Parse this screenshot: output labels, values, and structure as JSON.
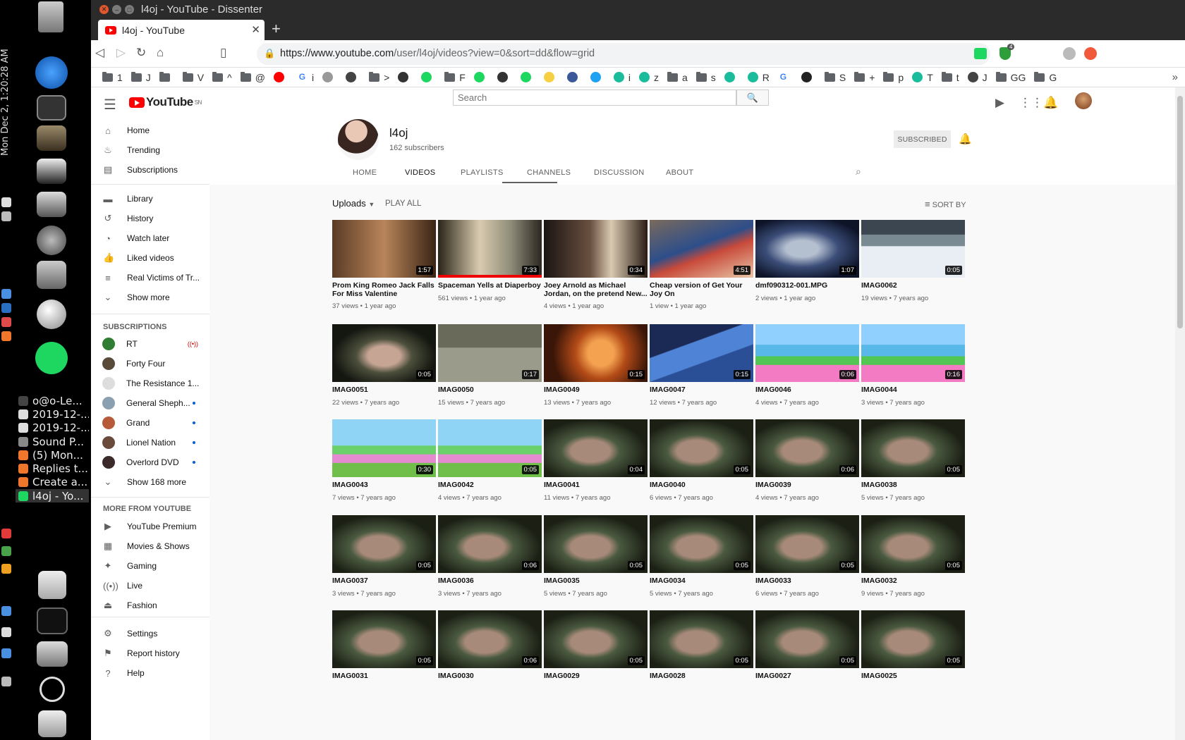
{
  "desktop": {
    "clock": "Mon Dec 2,  1:20:28 AM",
    "windows": [
      {
        "label": "o@o-Le...",
        "color": "#444"
      },
      {
        "label": "2019-12-...",
        "color": "#ddd"
      },
      {
        "label": "2019-12-...",
        "color": "#ddd"
      },
      {
        "label": "Sound P...",
        "color": "#888"
      },
      {
        "label": "(5) Mon...",
        "color": "#f0762c"
      },
      {
        "label": "Replies t...",
        "color": "#f0762c"
      },
      {
        "label": "Create a...",
        "color": "#f0762c"
      },
      {
        "label": "l4oj - Yo...",
        "color": "#1ed760",
        "active": true
      }
    ]
  },
  "browser": {
    "window_title": "l4oj - YouTube - Dissenter",
    "tab_title": "l4oj - YouTube",
    "url_host": "https://www.youtube.com",
    "url_path": "/user/l4oj/videos?view=0&sort=dd&flow=grid",
    "badge_count": "4",
    "bookmarks": [
      {
        "type": "folder",
        "label": "1"
      },
      {
        "type": "folder",
        "label": "J"
      },
      {
        "type": "folder",
        "label": ""
      },
      {
        "type": "folder",
        "label": "V"
      },
      {
        "type": "folder",
        "label": "^"
      },
      {
        "type": "folder",
        "label": "@"
      },
      {
        "type": "fav",
        "label": "",
        "color": "#f00"
      },
      {
        "type": "fav",
        "label": "i",
        "color": "#fff",
        "text": "G"
      },
      {
        "type": "fav",
        "label": "",
        "color": "#999"
      },
      {
        "type": "fav",
        "label": "",
        "color": "#444"
      },
      {
        "type": "folder",
        "label": ">"
      },
      {
        "type": "fav",
        "label": "",
        "color": "#333"
      },
      {
        "type": "fav",
        "label": "",
        "color": "#1ed760"
      },
      {
        "type": "folder",
        "label": "F"
      },
      {
        "type": "fav",
        "label": "",
        "color": "#1ed760"
      },
      {
        "type": "fav",
        "label": "",
        "color": "#333"
      },
      {
        "type": "fav",
        "label": "",
        "color": "#1ed760"
      },
      {
        "type": "fav",
        "label": "",
        "color": "#f5d042"
      },
      {
        "type": "fav",
        "label": "",
        "color": "#3b5998"
      },
      {
        "type": "fav",
        "label": "",
        "color": "#1da1f2"
      },
      {
        "type": "fav",
        "label": "i",
        "color": "#1abc9c"
      },
      {
        "type": "fav",
        "label": "z",
        "color": "#1abc9c"
      },
      {
        "type": "folder",
        "label": "a"
      },
      {
        "type": "folder",
        "label": "s"
      },
      {
        "type": "fav",
        "label": "",
        "color": "#1abc9c"
      },
      {
        "type": "fav",
        "label": "R",
        "color": "#1abc9c"
      },
      {
        "type": "fav",
        "label": "",
        "color": "#fff",
        "text": "G"
      },
      {
        "type": "fav",
        "label": "",
        "color": "#222"
      },
      {
        "type": "folder",
        "label": "S"
      },
      {
        "type": "folder",
        "label": "+"
      },
      {
        "type": "folder",
        "label": "p"
      },
      {
        "type": "fav",
        "label": "T",
        "color": "#1abc9c"
      },
      {
        "type": "folder",
        "label": "t"
      },
      {
        "type": "fav",
        "label": "J",
        "color": "#444"
      },
      {
        "type": "folder",
        "label": "GG"
      },
      {
        "type": "folder",
        "label": "G"
      }
    ]
  },
  "youtube": {
    "logo_text": "YouTube",
    "logo_sup": "SN",
    "search_placeholder": "Search",
    "sidebar": {
      "main": [
        {
          "label": "Home",
          "icon": "home-icon",
          "glyph": "⌂"
        },
        {
          "label": "Trending",
          "icon": "fire-icon",
          "glyph": "♨"
        },
        {
          "label": "Subscriptions",
          "icon": "subscriptions-icon",
          "glyph": "▤"
        }
      ],
      "library": [
        {
          "label": "Library",
          "icon": "folder-icon",
          "glyph": "▬"
        },
        {
          "label": "History",
          "icon": "history-icon",
          "glyph": "↺"
        },
        {
          "label": "Watch later",
          "icon": "clock-icon",
          "glyph": "◔"
        },
        {
          "label": "Liked videos",
          "icon": "thumbs-up-icon",
          "glyph": "👍"
        },
        {
          "label": "Real Victims of Tr...",
          "icon": "playlist-icon",
          "glyph": "≡"
        },
        {
          "label": "Show more",
          "icon": "chevron-down-icon",
          "glyph": "⌄"
        }
      ],
      "subscriptions_heading": "SUBSCRIPTIONS",
      "subscriptions": [
        {
          "label": "RT",
          "color": "#2e7d32",
          "live": true
        },
        {
          "label": "Forty Four",
          "color": "#5a4a3a"
        },
        {
          "label": "The Resistance 1...",
          "color": "#ddd"
        },
        {
          "label": "General Sheph...",
          "color": "#8aa0b0",
          "dot": true
        },
        {
          "label": "Grand",
          "color": "#b65a3a",
          "dot": true
        },
        {
          "label": "Lionel Nation",
          "color": "#6a4a3a",
          "dot": true
        },
        {
          "label": "Overlord DVD",
          "color": "#3a2a2a",
          "dot": true
        }
      ],
      "show_more_subs": "Show 168 more",
      "more_heading": "MORE FROM YOUTUBE",
      "more": [
        {
          "label": "YouTube Premium",
          "icon": "youtube-premium-icon",
          "glyph": "▶"
        },
        {
          "label": "Movies & Shows",
          "icon": "film-icon",
          "glyph": "▦"
        },
        {
          "label": "Gaming",
          "icon": "gaming-icon",
          "glyph": "✦"
        },
        {
          "label": "Live",
          "icon": "live-icon",
          "glyph": "((•))"
        },
        {
          "label": "Fashion",
          "icon": "hanger-icon",
          "glyph": "⏏"
        }
      ],
      "bottom": [
        {
          "label": "Settings",
          "icon": "settings-icon",
          "glyph": "⚙"
        },
        {
          "label": "Report history",
          "icon": "flag-icon",
          "glyph": "⚑"
        },
        {
          "label": "Help",
          "icon": "help-icon",
          "glyph": "?"
        }
      ]
    },
    "channel": {
      "name": "l4oj",
      "subscribers": "162 subscribers",
      "subscribe_label": "SUBSCRIBED",
      "tabs": [
        "HOME",
        "VIDEOS",
        "PLAYLISTS",
        "CHANNELS",
        "DISCUSSION",
        "ABOUT"
      ],
      "active_tab": "VIDEOS"
    },
    "grid": {
      "uploads_label": "Uploads",
      "play_all": "PLAY ALL",
      "sort_by": "SORT BY",
      "videos": [
        {
          "title": "Prom King Romeo Jack Falls For Miss Valentine",
          "meta": "37 views • 1 year ago",
          "duration": "1:57",
          "style": "room1"
        },
        {
          "title": "Spaceman Yells at Diaperboy",
          "meta": "561 views • 1 year ago",
          "duration": "7:33",
          "style": "room2",
          "watched": 1.0
        },
        {
          "title": "Joey Arnold as Michael Jordan, on the pretend New...",
          "meta": "4 views • 1 year ago",
          "duration": "0:34",
          "style": "room3"
        },
        {
          "title": "Cheap version of Get Your Joy On",
          "meta": "1 view • 1 year ago",
          "duration": "4:51",
          "style": "room4"
        },
        {
          "title": "dmf090312-001.MPG",
          "meta": "2 views • 1 year ago",
          "duration": "1:07",
          "style": "room5"
        },
        {
          "title": "IMAG0062",
          "meta": "19 views • 7 years ago",
          "duration": "0:05",
          "style": "snow"
        },
        {
          "title": "IMAG0051",
          "meta": "22 views • 7 years ago",
          "duration": "0:05",
          "style": "face2"
        },
        {
          "title": "IMAG0050",
          "meta": "15 views • 7 years ago",
          "duration": "0:17",
          "style": "chairs"
        },
        {
          "title": "IMAG0049",
          "meta": "13 views • 7 years ago",
          "duration": "0:15",
          "style": "fire"
        },
        {
          "title": "IMAG0047",
          "meta": "12 views • 7 years ago",
          "duration": "0:15",
          "style": "tv"
        },
        {
          "title": "IMAG0046",
          "meta": "4 views • 7 years ago",
          "duration": "0:06",
          "style": "game2"
        },
        {
          "title": "IMAG0044",
          "meta": "3 views • 7 years ago",
          "duration": "0:16",
          "style": "game2"
        },
        {
          "title": "IMAG0043",
          "meta": "7 views • 7 years ago",
          "duration": "0:30",
          "style": "game"
        },
        {
          "title": "IMAG0042",
          "meta": "4 views • 7 years ago",
          "duration": "0:05",
          "style": "game"
        },
        {
          "title": "IMAG0041",
          "meta": "11 views • 7 years ago",
          "duration": "0:04",
          "style": "face"
        },
        {
          "title": "IMAG0040",
          "meta": "6 views • 7 years ago",
          "duration": "0:05",
          "style": "face"
        },
        {
          "title": "IMAG0039",
          "meta": "4 views • 7 years ago",
          "duration": "0:06",
          "style": "face"
        },
        {
          "title": "IMAG0038",
          "meta": "5 views • 7 years ago",
          "duration": "0:05",
          "style": "face"
        },
        {
          "title": "IMAG0037",
          "meta": "3 views • 7 years ago",
          "duration": "0:05",
          "style": "face"
        },
        {
          "title": "IMAG0036",
          "meta": "3 views • 7 years ago",
          "duration": "0:06",
          "style": "face"
        },
        {
          "title": "IMAG0035",
          "meta": "5 views • 7 years ago",
          "duration": "0:05",
          "style": "face"
        },
        {
          "title": "IMAG0034",
          "meta": "5 views • 7 years ago",
          "duration": "0:05",
          "style": "face"
        },
        {
          "title": "IMAG0033",
          "meta": "6 views • 7 years ago",
          "duration": "0:05",
          "style": "face"
        },
        {
          "title": "IMAG0032",
          "meta": "9 views • 7 years ago",
          "duration": "0:05",
          "style": "face"
        },
        {
          "title": "IMAG0031",
          "meta": "",
          "duration": "0:05",
          "style": "face"
        },
        {
          "title": "IMAG0030",
          "meta": "",
          "duration": "0:06",
          "style": "face"
        },
        {
          "title": "IMAG0029",
          "meta": "",
          "duration": "0:05",
          "style": "face"
        },
        {
          "title": "IMAG0028",
          "meta": "",
          "duration": "0:05",
          "style": "face"
        },
        {
          "title": "IMAG0027",
          "meta": "",
          "duration": "0:05",
          "style": "face"
        },
        {
          "title": "IMAG0025",
          "meta": "",
          "duration": "0:05",
          "style": "face"
        }
      ]
    }
  }
}
